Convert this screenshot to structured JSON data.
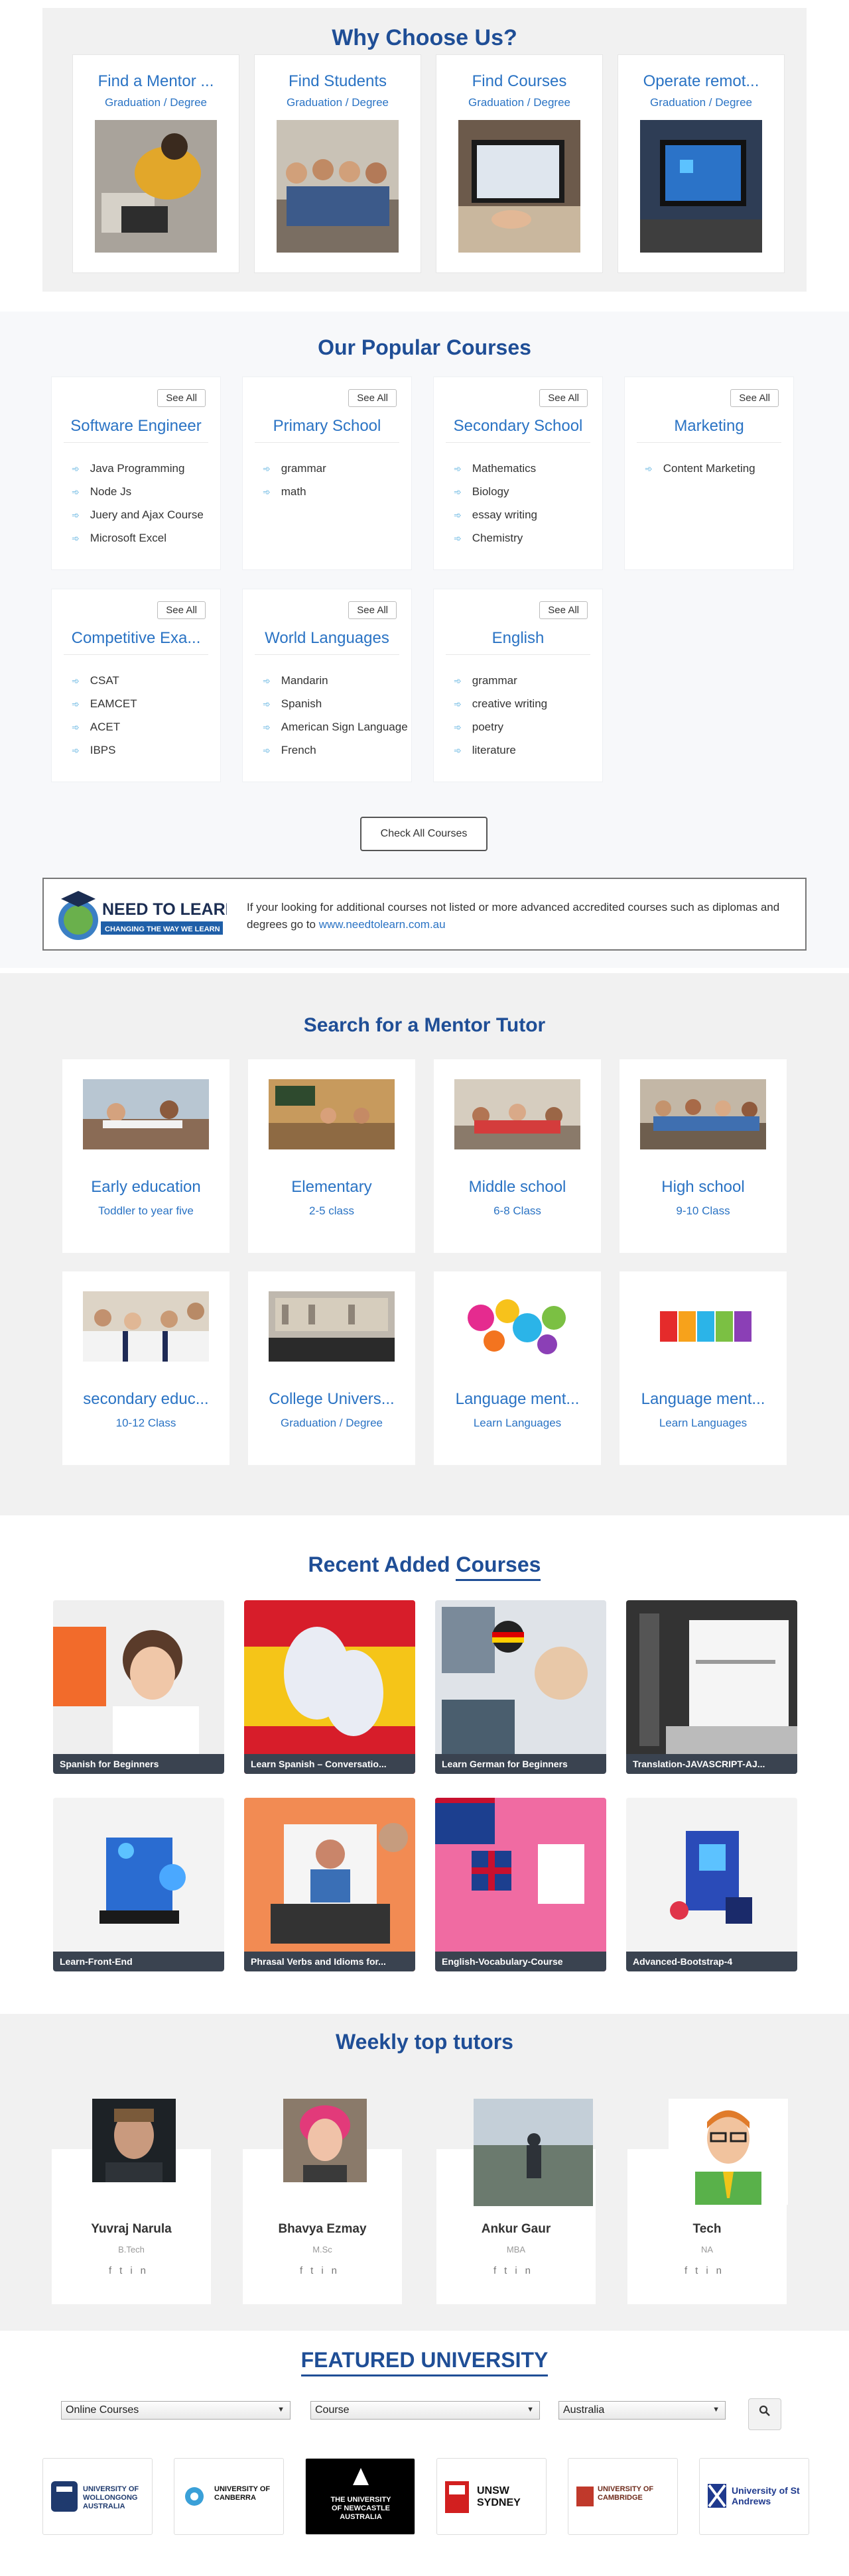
{
  "why": {
    "title": "Why Choose Us?",
    "cards": [
      {
        "title": "Find a Mentor ...",
        "sub": "Graduation / Degree"
      },
      {
        "title": "Find Students",
        "sub": "Graduation / Degree"
      },
      {
        "title": "Find Courses",
        "sub": "Graduation / Degree"
      },
      {
        "title": "Operate remot...",
        "sub": "Graduation / Degree"
      }
    ]
  },
  "popular": {
    "title": "Our Popular Courses",
    "see_all": "See All",
    "cards": [
      {
        "title": "Software Engineer",
        "items": [
          "Java Programming",
          "Node Js",
          "Juery and Ajax Course",
          "Microsoft Excel"
        ]
      },
      {
        "title": "Primary School",
        "items": [
          "grammar",
          "math"
        ]
      },
      {
        "title": "Secondary School",
        "items": [
          "Mathematics",
          "Biology",
          "essay writing",
          "Chemistry"
        ]
      },
      {
        "title": "Marketing",
        "items": [
          "Content Marketing"
        ]
      },
      {
        "title": "Competitive Exa...",
        "items": [
          "CSAT",
          "EAMCET",
          "ACET",
          "IBPS"
        ]
      },
      {
        "title": "World Languages",
        "items": [
          "Mandarin",
          "Spanish",
          "American Sign Language",
          "French"
        ]
      },
      {
        "title": "English",
        "items": [
          "grammar",
          "creative writing",
          "poetry",
          "literature"
        ]
      }
    ],
    "check_all": "Check All Courses",
    "banner": {
      "logo_main": "NEED TO LEARN",
      "logo_tag": "CHANGING THE WAY WE LEARN",
      "text": "If your looking for additional courses not listed or more advanced accredited courses such as diplomas and degrees go to",
      "link": "www.needtolearn.com.au"
    }
  },
  "search": {
    "title": "Search for a Mentor Tutor",
    "cards": [
      {
        "title": "Early education",
        "sub": "Toddler to year five"
      },
      {
        "title": "Elementary",
        "sub": "2-5 class"
      },
      {
        "title": "Middle school",
        "sub": "6-8 Class"
      },
      {
        "title": "High school",
        "sub": "9-10 Class"
      },
      {
        "title": "secondary educ...",
        "sub": "10-12 Class"
      },
      {
        "title": "College Univers...",
        "sub": "Graduation / Degree"
      },
      {
        "title": "Language ment...",
        "sub": "Learn Languages"
      },
      {
        "title": "Language ment...",
        "sub": "Learn Languages"
      }
    ]
  },
  "recent": {
    "title_a": "Recent Added ",
    "title_b": "Courses",
    "cards": [
      "Spanish for Beginners",
      "Learn Spanish – Conversatio...",
      "Learn German for Beginners",
      "Translation-JAVASCRIPT-AJ...",
      "Learn-Front-End",
      "Phrasal Verbs and Idioms for...",
      "English-Vocabulary-Course",
      "Advanced-Bootstrap-4"
    ]
  },
  "tutors": {
    "title": "Weekly top tutors",
    "people": [
      {
        "name": "Yuvraj Narula",
        "degree": "B.Tech"
      },
      {
        "name": "Bhavya Ezmay",
        "degree": "M.Sc"
      },
      {
        "name": "Ankur Gaur",
        "degree": "MBA"
      },
      {
        "name": "Tech",
        "degree": "NA"
      }
    ],
    "social": [
      "f",
      "t",
      "in"
    ]
  },
  "featured": {
    "title": "FEATURED UNIVERSITY",
    "selects": [
      "Online Courses",
      "Course",
      "Australia"
    ],
    "universities": [
      "UNIVERSITY OF WOLLONGONG AUSTRALIA",
      "UNIVERSITY OF CANBERRA",
      "THE UNIVERSITY OF NEWCASTLE AUSTRALIA",
      "UNSW SYDNEY",
      "UNIVERSITY OF CAMBRIDGE",
      "University of St Andrews"
    ]
  },
  "colors": {
    "accent": "#1f4e96",
    "link": "#2a73c4",
    "label_bar": "#3a4350"
  }
}
